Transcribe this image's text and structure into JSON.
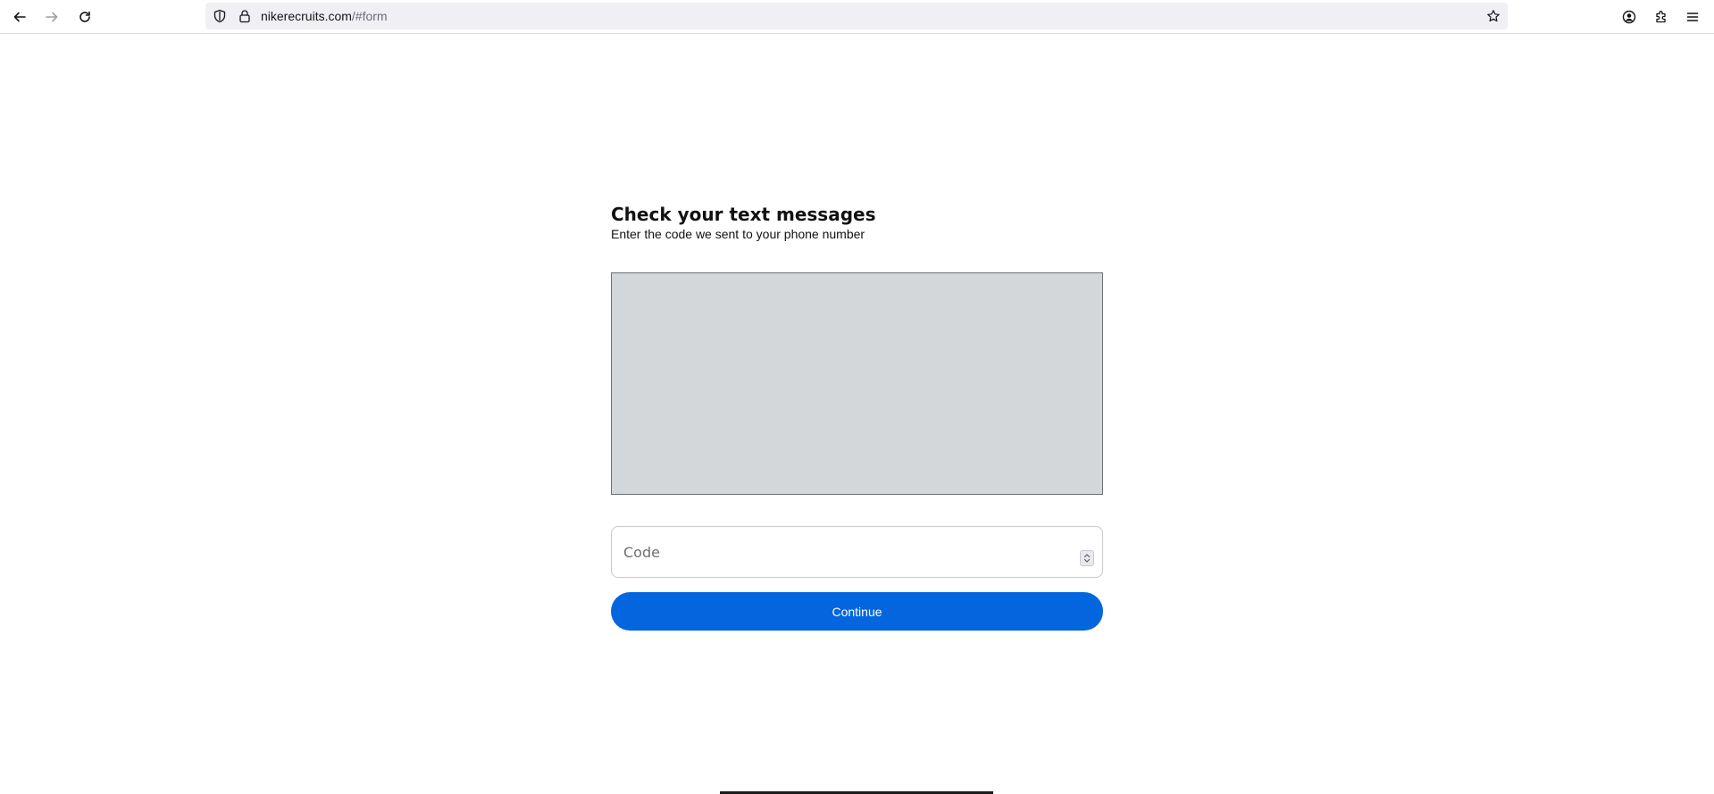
{
  "browser": {
    "url_host": "nikerecruits.com",
    "url_path": "/#form",
    "icons": {
      "back": "back-arrow-icon",
      "forward": "forward-arrow-icon",
      "reload": "reload-icon",
      "shield": "shield-icon",
      "lock": "lock-icon",
      "bookmark": "star-icon",
      "account": "account-icon",
      "extensions": "puzzle-icon",
      "menu": "hamburger-menu-icon"
    }
  },
  "form": {
    "title": "Check your text messages",
    "subtitle": "Enter the code we sent to your phone number",
    "code_placeholder": "Code",
    "code_value": "",
    "continue_label": "Continue"
  },
  "colors": {
    "primary_button": "#0466de",
    "captcha_background": "#d3d7da"
  }
}
